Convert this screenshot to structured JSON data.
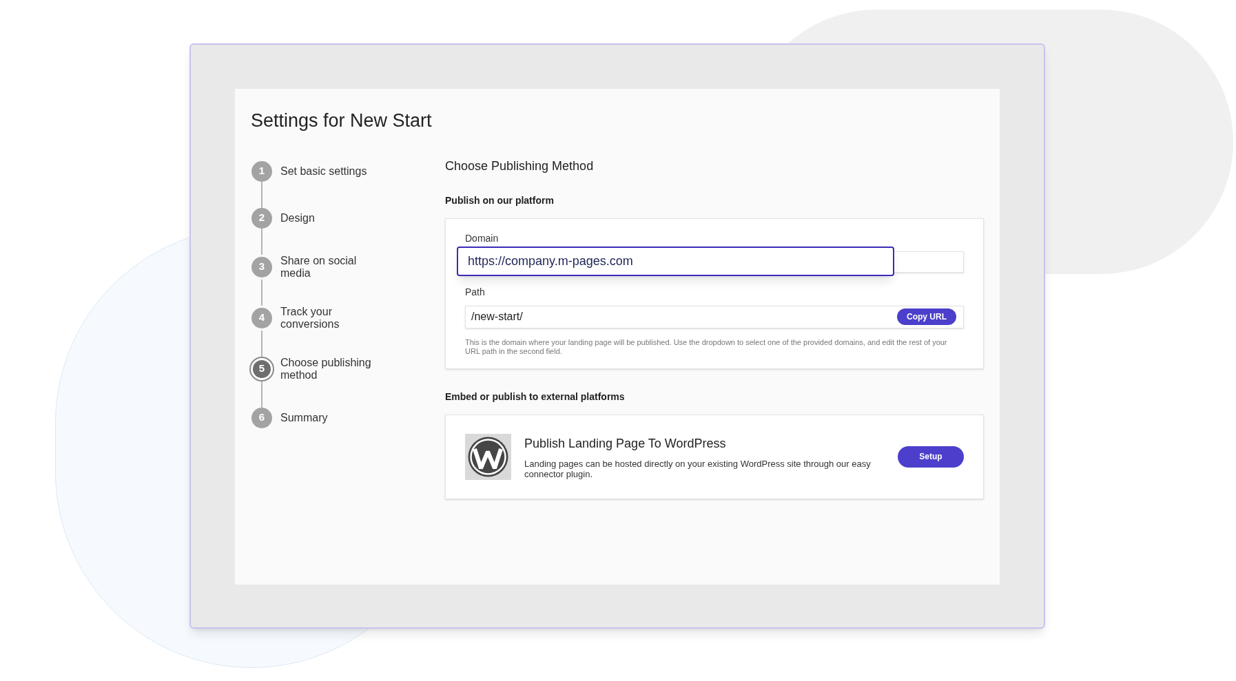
{
  "title": "Settings for New Start",
  "steps": [
    {
      "number": "1",
      "label": "Set basic settings",
      "selected": false
    },
    {
      "number": "2",
      "label": "Design",
      "selected": false
    },
    {
      "number": "3",
      "label": "Share on social media",
      "selected": false
    },
    {
      "number": "4",
      "label": "Track your conversions",
      "selected": false
    },
    {
      "number": "5",
      "label": "Choose publishing method",
      "selected": true
    },
    {
      "number": "6",
      "label": "Summary",
      "selected": false
    }
  ],
  "section_title": "Choose Publishing Method",
  "platform": {
    "heading": "Publish on our platform",
    "domain_label": "Domain",
    "domain_value": "https://company.m-pages.com",
    "domain_focused": true,
    "path_label": "Path",
    "path_value": "/new-start/",
    "copy_button": "Copy URL",
    "help": "This is the domain where your landing page will be published. Use the dropdown to select one of the provided domains, and edit the rest of your URL path in the second field."
  },
  "external": {
    "heading": "Embed or publish to external platforms",
    "title": "Publish Landing Page To WordPress",
    "description": "Landing pages can be hosted directly on your existing WordPress site through our easy connector plugin.",
    "button": "Setup"
  }
}
